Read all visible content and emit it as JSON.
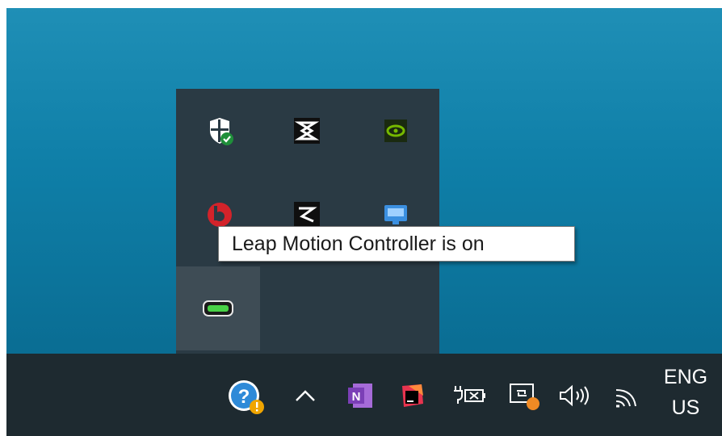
{
  "tooltip": {
    "text": "Leap Motion Controller is on"
  },
  "tray_overflow": {
    "icons": [
      "windows-security-icon",
      "virtualbox-icon",
      "nvidia-icon",
      "beats-icon",
      "virtualbox-dark-icon",
      "monitor-display-icon",
      "leap-motion-icon"
    ]
  },
  "taskbar": {
    "icons": [
      "help-warning-icon",
      "show-hidden-icons-chevron",
      "onenote-icon",
      "jetbrains-toolbox-icon",
      "power-plug-battery-icon",
      "display-sync-icon",
      "volume-icon",
      "wifi-icon"
    ],
    "language": {
      "line1": "ENG",
      "line2": "US"
    }
  },
  "colors": {
    "desktop": "#1083ad",
    "tray_background": "#2a3a44",
    "taskbar": "#1e2a30",
    "leap_green": "#48d147",
    "nvidia_green": "#76b900",
    "beats_red": "#d2232a",
    "onenote_purple": "#7b3fb6"
  }
}
